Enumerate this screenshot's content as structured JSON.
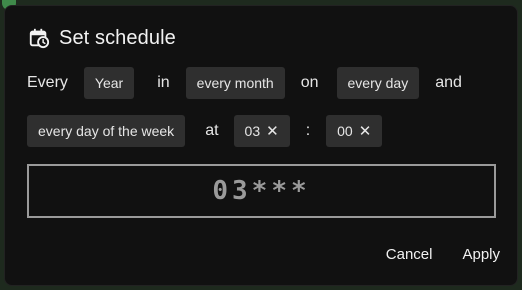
{
  "dialog": {
    "title": "Set schedule",
    "icon": "calendar-clock-icon"
  },
  "schedule": {
    "every_label": "Every",
    "period_value": "Year",
    "in_label": "in",
    "month_value": "every month",
    "on_label": "on",
    "day_value": "every day",
    "and_label": "and",
    "weekday_value": "every day of the week",
    "at_label": "at",
    "hour_value": "03",
    "colon_label": ":",
    "minute_value": "00",
    "clear_glyph": "✕"
  },
  "cron_expression": "03***",
  "actions": {
    "cancel_label": "Cancel",
    "apply_label": "Apply"
  }
}
